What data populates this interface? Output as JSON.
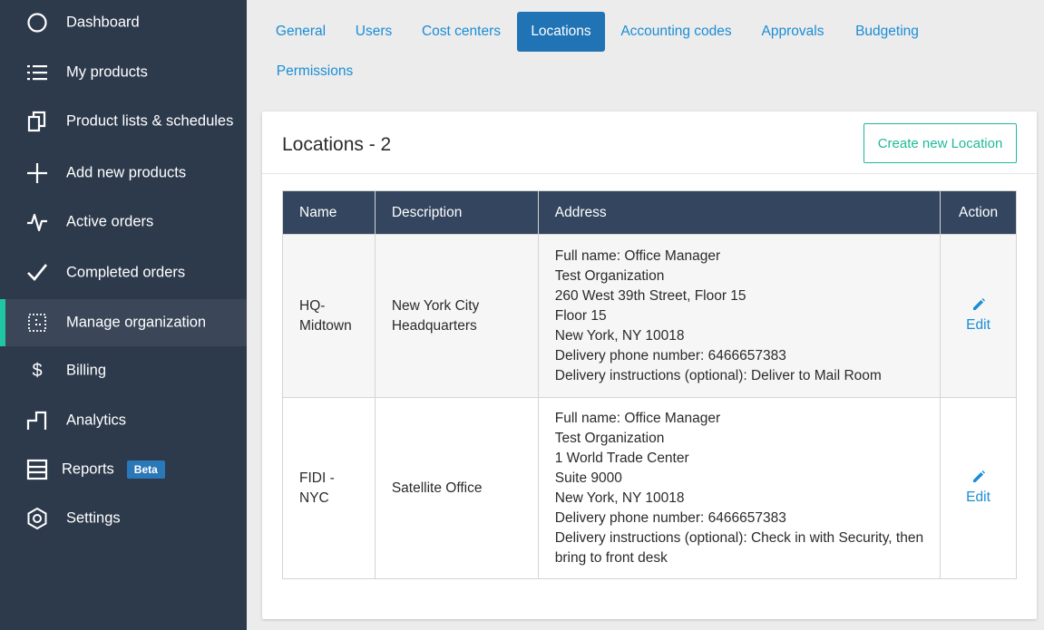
{
  "sidebar": {
    "items": [
      {
        "label": "Dashboard",
        "icon": "circle-icon"
      },
      {
        "label": "My products",
        "icon": "list-icon"
      },
      {
        "label": "Product lists & schedules",
        "icon": "copy-icon"
      },
      {
        "label": "Add new products",
        "icon": "plus-icon"
      },
      {
        "label": "Active orders",
        "icon": "pulse-icon"
      },
      {
        "label": "Completed orders",
        "icon": "check-icon"
      },
      {
        "label": "Manage organization",
        "icon": "organization-icon",
        "active": true
      },
      {
        "label": "Billing",
        "icon": "dollar-icon"
      },
      {
        "label": "Analytics",
        "icon": "analytics-icon"
      },
      {
        "label": "Reports",
        "icon": "reports-icon",
        "badge": "Beta"
      },
      {
        "label": "Settings",
        "icon": "gear-icon"
      }
    ]
  },
  "tabs": [
    {
      "label": "General"
    },
    {
      "label": "Users"
    },
    {
      "label": "Cost centers"
    },
    {
      "label": "Locations",
      "active": true
    },
    {
      "label": "Accounting codes"
    },
    {
      "label": "Approvals"
    },
    {
      "label": "Budgeting"
    },
    {
      "label": "Permissions"
    }
  ],
  "card": {
    "title": "Locations - 2",
    "create_label": "Create new Location"
  },
  "table": {
    "headers": {
      "name": "Name",
      "description": "Description",
      "address": "Address",
      "action": "Action"
    },
    "rows": [
      {
        "name_lines": [
          "HQ-",
          "Midtown"
        ],
        "description_lines": [
          "New York City",
          "Headquarters"
        ],
        "address_lines": [
          "Full name: Office Manager",
          "Test Organization",
          "260 West 39th Street, Floor 15",
          "Floor 15",
          "New York, NY 10018",
          "Delivery phone number: 6466657383",
          "Delivery instructions (optional): Deliver to Mail Room"
        ],
        "action_label": "Edit"
      },
      {
        "name_lines": [
          "FIDI -",
          "NYC"
        ],
        "description_lines": [
          "Satellite Office"
        ],
        "address_lines": [
          "Full name: Office Manager",
          "Test Organization",
          "1 World Trade Center",
          "Suite 9000",
          "New York, NY 10018",
          "Delivery phone number: 6466657383",
          "Delivery instructions (optional): Check in with Security, then",
          "bring to front desk"
        ],
        "action_label": "Edit"
      }
    ]
  },
  "colors": {
    "sidebar_bg": "#2d3a4c",
    "active_accent": "#1fc7a2",
    "tab_active_bg": "#2073b5",
    "link": "#1a8dd6",
    "table_header_bg": "#33455f",
    "create_button": "#1fb99a",
    "beta_badge": "#2a78b8"
  }
}
